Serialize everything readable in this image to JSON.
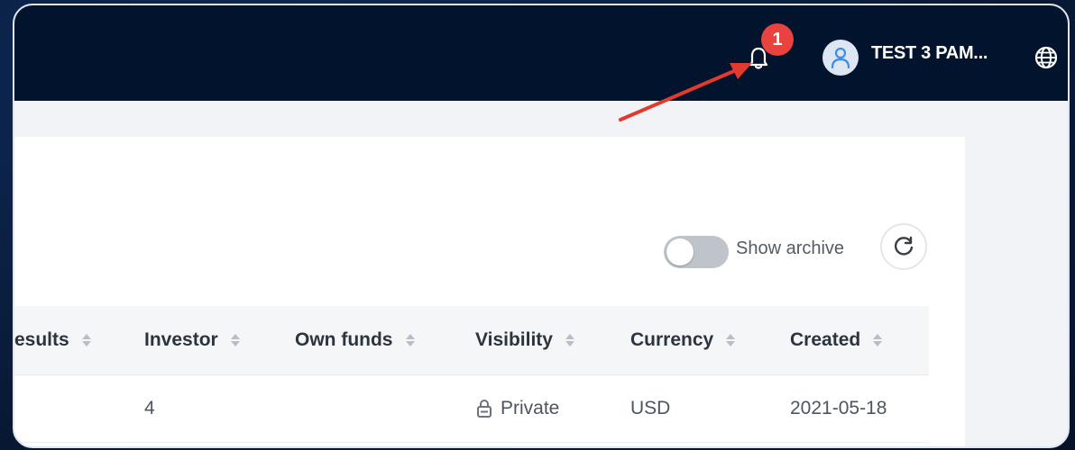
{
  "header": {
    "notification_count": "1",
    "user_name": "TEST 3 PAM..."
  },
  "toolbar": {
    "archive_label": "Show archive",
    "archive_enabled": false
  },
  "table": {
    "columns": [
      "esults",
      "Investor",
      "Own funds",
      "Visibility",
      "Currency",
      "Created"
    ],
    "rows": [
      {
        "results": "",
        "investor": "4",
        "own_funds": "",
        "visibility": "Private",
        "currency": "USD",
        "created": "2021-05-18"
      }
    ]
  },
  "colors": {
    "topbar": "#02132d",
    "badge": "#e8433f",
    "annotation_arrow": "#e23a2e"
  }
}
